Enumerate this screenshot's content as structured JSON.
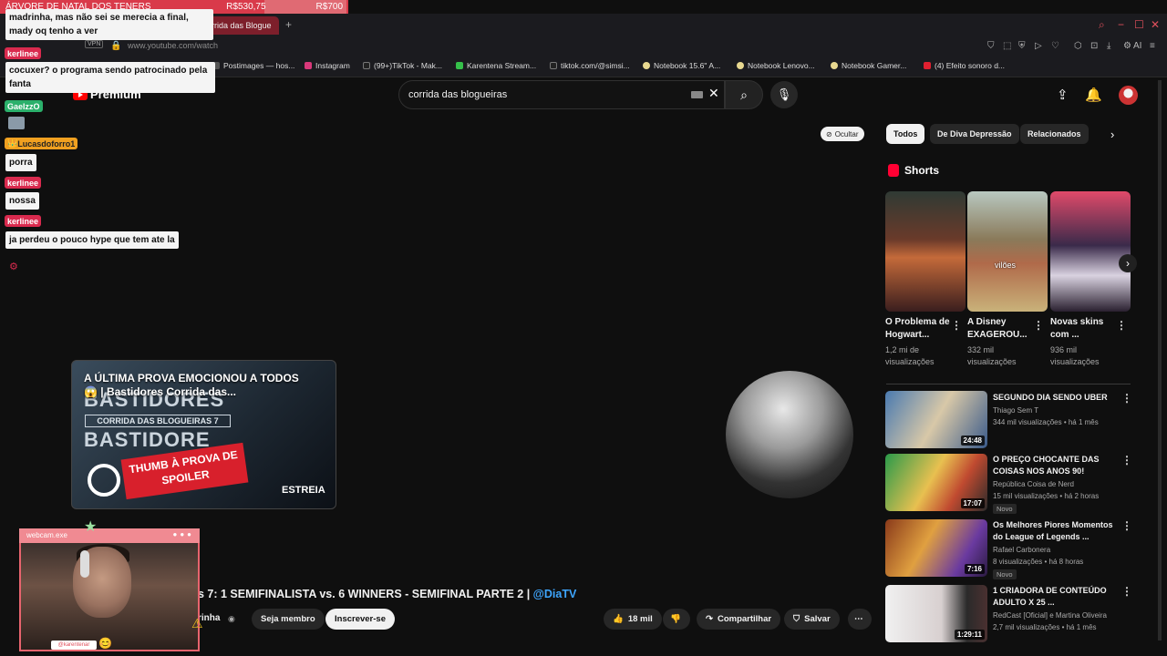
{
  "goal": {
    "label": "ÁRVORE DE NATAL DOS TENERS",
    "current": "R$530,75",
    "target": "R$700"
  },
  "browser": {
    "active_tab": "rrida das Blogue",
    "url": "www.youtube.com/watch",
    "vpn": "VPN",
    "bookmarks": [
      "Postimages — hos...",
      "Instagram",
      "(99+)TikTok - Mak...",
      "Karentena Stream...",
      "tiktok.com/@simsi...",
      "Notebook 15.6'' A...",
      "Notebook Lenovo...",
      "Notebook Gamer...",
      "(4) Efeito sonoro d..."
    ],
    "ai_label": "AI"
  },
  "youtube": {
    "logo": "Premium",
    "search_value": "corrida das blogueiras",
    "ocultar": "Ocultar",
    "chips": [
      "Todos",
      "De Diva Depressão",
      "Relacionados"
    ],
    "shorts_title": "Shorts",
    "shorts": [
      {
        "title": "O Problema de Hogwart...",
        "views": "1,2 mi de visualizações",
        "colors": [
          "#5a1c1c",
          "#c66a3a",
          "#3a3d3a"
        ]
      },
      {
        "title": "A Disney EXAGEROU...",
        "views": "332 mil visualizações",
        "overlay": "vilões",
        "colors": [
          "#7a8a6a",
          "#b86a4a",
          "#c9c7a2"
        ]
      },
      {
        "title": "Novas skins com ...",
        "views": "936 mil visualizações",
        "colors": [
          "#c0394f",
          "#3a2a4a",
          "#e6bfc7"
        ]
      }
    ],
    "recommendations": [
      {
        "title": "SEGUNDO DIA SENDO UBER",
        "channel": "Thiago Sem T",
        "meta": "344 mil visualizações • há 1 mês",
        "duration": "24:48",
        "novo": "",
        "colors": [
          "#5a8ac0",
          "#e0d0b0"
        ]
      },
      {
        "title": "O PREÇO CHOCANTE DAS COISAS NOS ANOS 90!",
        "channel": "República Coisa de Nerd",
        "meta": "15 mil visualizações • há 2 horas",
        "duration": "17:07",
        "novo": "Novo",
        "colors": [
          "#2a9a4a",
          "#e8c050"
        ]
      },
      {
        "title": "Os Melhores Piores Momentos do League of Legends ...",
        "channel": "Rafael Carbonera",
        "meta": "8 visualizações • há 8 horas",
        "duration": "7:16",
        "novo": "Novo",
        "colors": [
          "#c8502a",
          "#6a3aa0"
        ]
      },
      {
        "title": "1 CRIADORA DE CONTEÚDO ADULTO X 25 ...",
        "channel": "RedCast [Oficial] e Martina Oliveira",
        "meta": "2,7 mil visualizações • há 1 mês",
        "duration": "1:29:11",
        "novo": "",
        "colors": [
          "#e8e8e8",
          "#2a2a2a"
        ]
      }
    ],
    "video_card": {
      "title": "A ÚLTIMA PROVA EMOCIONOU A TODOS 😱 | Bastidores Corrida das...",
      "big1": "BASTIDORES",
      "sub": "CORRIDA DAS BLOGUEIRAS 7",
      "big2": "BASTIDORE",
      "banner": "THUMB À PROVA DE SPOILER",
      "badge": "ESTREIA"
    },
    "video_title": "s 7: 1 SEMIFINALISTA vs. 6 WINNERS - SEMIFINAL PARTE 2 | ",
    "video_tag": "@DiaTV",
    "channel_name": "rinha",
    "join_label": "Seja membro",
    "subscribe_label": "Inscrever-se",
    "likes": "18 mil",
    "share_label": "Compartilhar",
    "save_label": "Salvar"
  },
  "chat": [
    {
      "type": "bubble",
      "text": "madrinha, mas não sei se merecia a final, mady oq tenho a ver"
    },
    {
      "type": "name",
      "text": "kerlinee",
      "color": "#d92a4e"
    },
    {
      "type": "bubble",
      "text": "cocuxer? o programa sendo patrocinado pela fanta"
    },
    {
      "type": "name",
      "text": "GaeIzzO",
      "color": "#2bb06b"
    },
    {
      "type": "name",
      "text": "Lucasdoforro1",
      "color": "#f0a020"
    },
    {
      "type": "bubble",
      "text": "porra"
    },
    {
      "type": "name",
      "text": "kerlinee",
      "color": "#d92a4e"
    },
    {
      "type": "bubble",
      "text": "nossa"
    },
    {
      "type": "name",
      "text": "kerlinee",
      "color": "#d92a4e"
    },
    {
      "type": "bubble",
      "text": "ja perdeu o pouco hype que tem ate la"
    }
  ],
  "webcam": {
    "title": "webcam.exe",
    "handle": "@karentenar"
  }
}
